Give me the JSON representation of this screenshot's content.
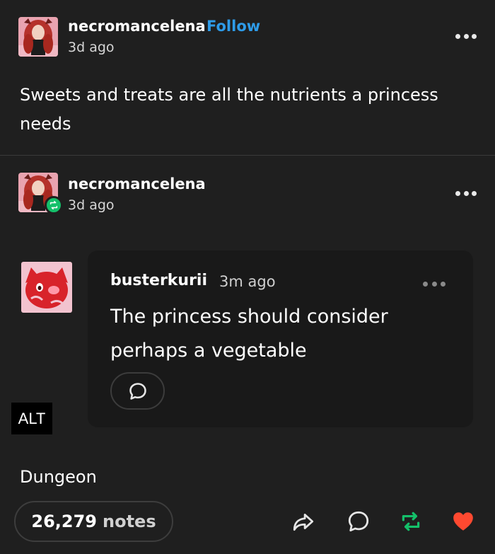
{
  "original_post": {
    "username": "necromancelena",
    "follow_label": "Follow",
    "time": "3d ago",
    "text": "Sweets and treats are all the nutrients a princess needs"
  },
  "reblog": {
    "username": "necromancelena",
    "time": "3d ago"
  },
  "reply": {
    "username": "busterkurii",
    "time": "3m ago",
    "text": "The princess should consider perhaps a vegetable"
  },
  "alt_label": "ALT",
  "tag_text": "Dungeon",
  "footer": {
    "notes_count": "26,279",
    "notes_label": "notes"
  },
  "colors": {
    "background": "#1f1f1f",
    "follow": "#2e9be8",
    "reblog_green": "#14c06a",
    "like_red": "#ff4930"
  },
  "icons": [
    "more-dots-icon",
    "reblog-icon",
    "comment-icon",
    "share-icon",
    "heart-icon"
  ]
}
